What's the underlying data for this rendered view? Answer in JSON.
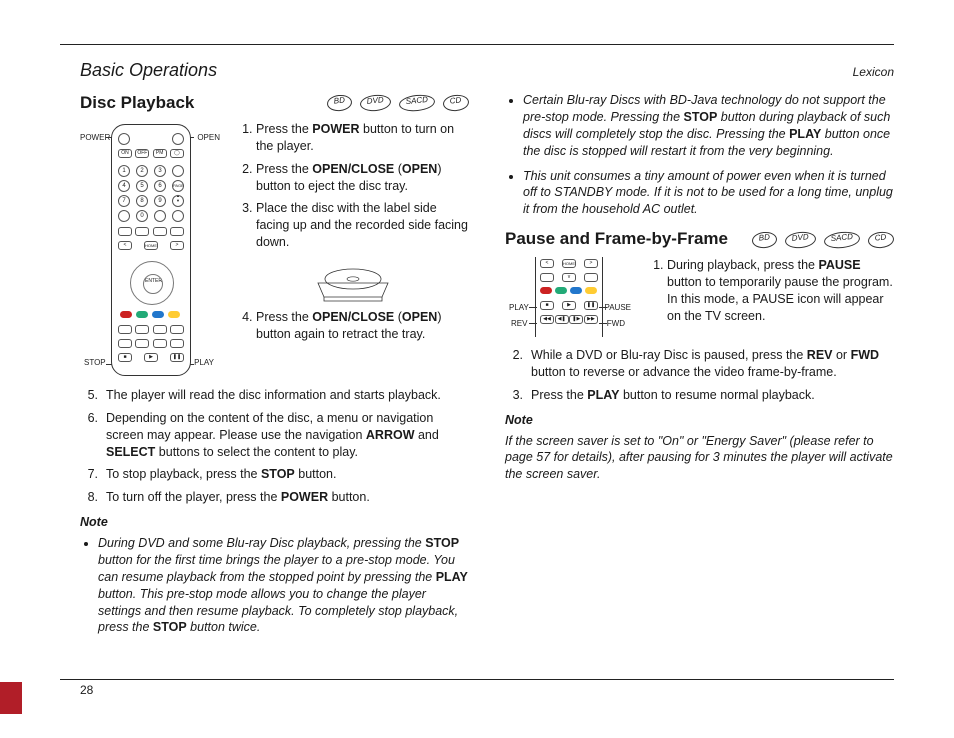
{
  "running_head": {
    "left": "Basic Operations",
    "right": "Lexicon"
  },
  "page_number": "28",
  "media_pills": [
    "BD",
    "DVD",
    "SACD",
    "CD"
  ],
  "disc_playback": {
    "title": "Disc Playback",
    "remote_labels": {
      "power": "POWER",
      "open": "OPEN",
      "stop": "STOP",
      "play": "PLAY"
    },
    "steps_1_4": [
      "Press the <b>POWER</b> button to turn on the player.",
      "Press the <b>OPEN/CLOSE</b> (<b>OPEN</b>) button to eject the disc tray.",
      "Place the disc with the label side facing up and the recorded side facing down.",
      "Press the <b>OPEN/CLOSE</b> (<b>OPEN</b>) button again to retract the tray."
    ],
    "steps_5_8": [
      {
        "n": "5.",
        "t": "The player will read the disc information and starts playback."
      },
      {
        "n": "6.",
        "t": "Depending on the content of the disc, a menu or navigation screen may appear. Please use the navigation <b>ARROW</b> and <b>SELECT</b> buttons to select the content to play."
      },
      {
        "n": "7.",
        "t": "To stop playback, press the <b>STOP</b> button."
      },
      {
        "n": "8.",
        "t": "To turn off the player, press the <b>POWER</b> button."
      }
    ],
    "note_heading": "Note",
    "note_bullets": [
      "During DVD and some Blu-ray Disc playback, pressing the <b>STOP</b> button for the first time brings the player to a pre-stop mode. You can resume playback from the stopped point by pressing the <b>PLAY</b> button. This pre-stop mode allows you to change the player settings and then resume playback. To completely stop playback, press the <b>STOP</b> button twice.",
      "Certain Blu-ray Discs with BD-Java technology do not support the pre-stop mode. Pressing the <b>STOP</b> button during playback of such discs will completely stop the disc. Pressing the <b>PLAY</b> button once the disc is stopped will restart it from the very beginning.",
      "This unit consumes a tiny amount of power even when it is turned off to STANDBY mode. If it is not to be used for a long time, unplug it from the household AC outlet."
    ]
  },
  "pause": {
    "title": "Pause and Frame-by-Frame",
    "remote_labels": {
      "play": "PLAY",
      "rev": "REV",
      "pause": "PAUSE",
      "fwd": "FWD"
    },
    "step1": "During playback, press the <b>PAUSE</b> button to temporarily pause the program. In this mode, a PAUSE icon will appear on the TV screen.",
    "steps_2_3": [
      {
        "n": "2.",
        "t": "While a DVD or Blu-ray Disc is paused, press the <b>REV</b> or <b>FWD</b> button to reverse or advance the video frame-by-frame."
      },
      {
        "n": "3.",
        "t": "Press the <b>PLAY</b> button to resume normal playback."
      }
    ],
    "note_heading": "Note",
    "note_body": "If the screen saver is set to \"On\" or \"Energy Saver\" (please refer to page 57 for details), after pausing for 3 minutes the player will activate the screen saver."
  }
}
